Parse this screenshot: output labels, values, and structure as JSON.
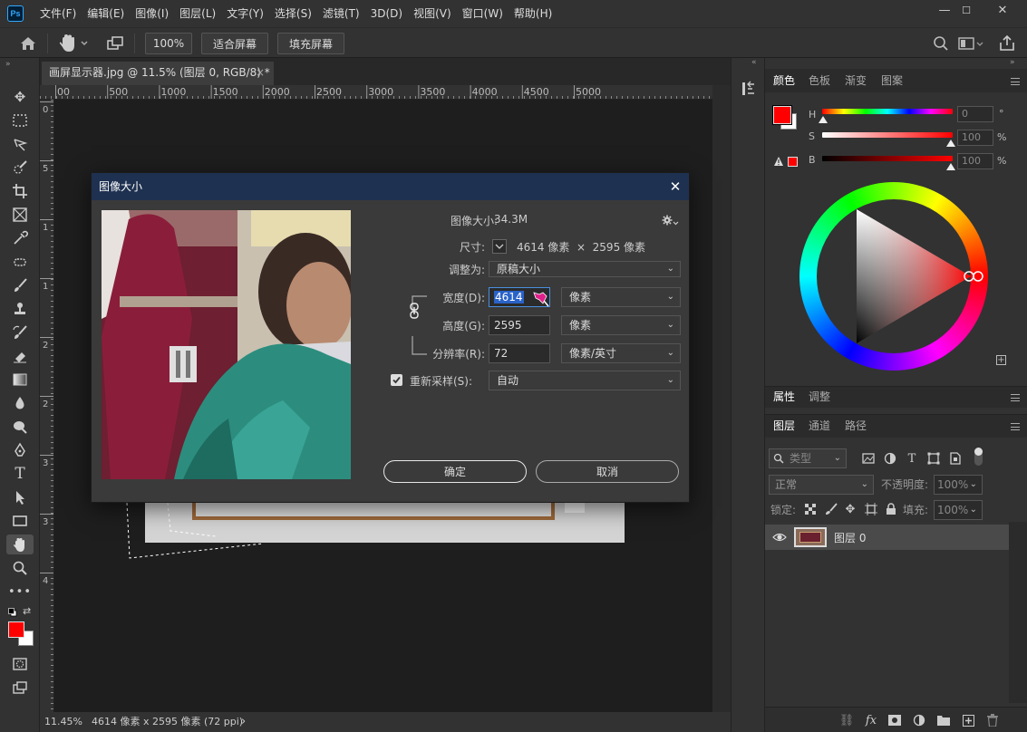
{
  "app": {
    "logo": "Ps"
  },
  "menu": [
    "文件(F)",
    "编辑(E)",
    "图像(I)",
    "图层(L)",
    "文字(Y)",
    "选择(S)",
    "滤镜(T)",
    "3D(D)",
    "视图(V)",
    "窗口(W)",
    "帮助(H)"
  ],
  "window_controls": {
    "minimize": "—",
    "restore": "☐",
    "close": "✕"
  },
  "options": {
    "zoom": "100%",
    "fit_screen": "适合屏幕",
    "fill_screen": "填充屏幕"
  },
  "document": {
    "tab_title": "画屏显示器.jpg @ 11.5% (图层 0, RGB/8) *",
    "close": "×"
  },
  "ruler_h": [
    "00",
    "500",
    "1000",
    "1500",
    "2000",
    "2500",
    "3000",
    "3500",
    "4000",
    "4500",
    "5000"
  ],
  "ruler_v": [
    "0",
    "5",
    "1",
    "1",
    "2",
    "2",
    "3",
    "3",
    "4"
  ],
  "status": {
    "zoom": "11.45%",
    "info": "4614 像素 x 2595 像素 (72 ppi)",
    "arrow": "›"
  },
  "color_panel": {
    "tabs": [
      "颜色",
      "色板",
      "渐变",
      "图案"
    ],
    "h_label": "H",
    "s_label": "S",
    "b_label": "B",
    "h_value": "0",
    "s_value": "100",
    "b_value": "100",
    "h_unit": "°",
    "s_unit": "%",
    "b_unit": "%",
    "fg": "#ff0000",
    "bg": "#ffffff"
  },
  "props_panel": {
    "tabs": [
      "属性",
      "调整"
    ]
  },
  "layers_panel": {
    "tabs": [
      "图层",
      "通道",
      "路径"
    ],
    "filter_kind": "类型",
    "blend_mode": "正常",
    "opacity_label": "不透明度:",
    "opacity_value": "100%",
    "lock_label": "锁定:",
    "fill_label": "填充:",
    "fill_value": "100%",
    "layer_name": "图层 0"
  },
  "dialog": {
    "title": "图像大小",
    "image_size_label": "图像大小:",
    "image_size_value": "34.3M",
    "dimensions_label": "尺寸:",
    "dimensions_value": "4614 像素  ×  2595 像素",
    "fit_to_label": "调整为:",
    "fit_to_value": "原稿大小",
    "width_label": "宽度(D):",
    "width_value": "4614",
    "width_unit": "像素",
    "height_label": "高度(G):",
    "height_value": "2595",
    "height_unit": "像素",
    "resolution_label": "分辨率(R):",
    "resolution_value": "72",
    "resolution_unit": "像素/英寸",
    "resample_label": "重新采样(S):",
    "resample_value": "自动",
    "ok": "确定",
    "cancel": "取消",
    "close": "✕"
  }
}
